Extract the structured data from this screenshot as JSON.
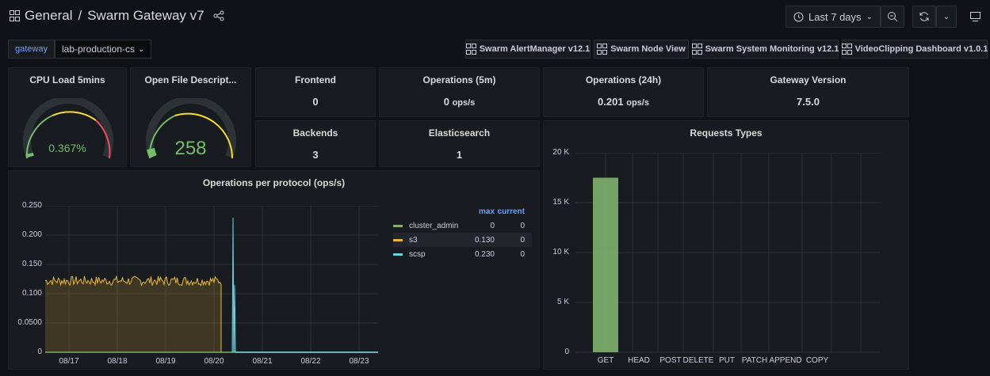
{
  "header": {
    "breadcrumb_folder": "General",
    "breadcrumb_sep": "/",
    "dashboard_title": "Swarm Gateway v7",
    "time_range": "Last 7 days"
  },
  "variables": {
    "label": "gateway",
    "value": "lab-production-cs"
  },
  "links": [
    "Swarm AlertManager v12.1",
    "Swarm Node View",
    "Swarm System Monitoring v12.1",
    "VideoClipping Dashboard v1.0.1"
  ],
  "panels": {
    "cpu": {
      "title": "CPU Load 5mins",
      "value": "0.367%",
      "level": 0.00367
    },
    "files": {
      "title": "Open File Descript...",
      "value": "258"
    },
    "frontend": {
      "title": "Frontend",
      "value": "0"
    },
    "ops5m": {
      "title": "Operations (5m)",
      "value": "0",
      "unit": "ops/s"
    },
    "ops24h": {
      "title": "Operations (24h)",
      "value": "0.201",
      "unit": "ops/s"
    },
    "version": {
      "title": "Gateway Version",
      "value": "7.5.0"
    },
    "backends": {
      "title": "Backends",
      "value": "3"
    },
    "elastic": {
      "title": "Elasticsearch",
      "value": "1"
    }
  },
  "ops_chart": {
    "title": "Operations per protocol (ops/s)",
    "legend_headers": {
      "max": "max",
      "current": "current"
    },
    "legend": [
      {
        "name": "cluster_admin",
        "max": "0",
        "current": "0",
        "color": "#7eb26d"
      },
      {
        "name": "s3",
        "max": "0.130",
        "current": "0",
        "color": "#eab839"
      },
      {
        "name": "scsp",
        "max": "0.230",
        "current": "0",
        "color": "#6ed0e0"
      }
    ]
  },
  "req_chart": {
    "title": "Requests Types"
  },
  "chart_data": [
    {
      "type": "line",
      "title": "Operations per protocol (ops/s)",
      "x": [
        "08/17",
        "08/18",
        "08/19",
        "08/20",
        "08/21",
        "08/22",
        "08/23"
      ],
      "y_ticks": [
        "0.250",
        "0.200",
        "0.150",
        "0.100",
        "0.0500",
        "0"
      ],
      "ylim": [
        0,
        0.25
      ],
      "series": [
        {
          "name": "cluster_admin",
          "description": "flat at 0"
        },
        {
          "name": "s3",
          "description": "noisy around 0.115-0.13 from 08/16 to 08/20 ~12:00, then 0",
          "level": 0.12,
          "max": 0.13
        },
        {
          "name": "scsp",
          "description": "0 except spike to 0.230 near 08/20 ~18:00",
          "max": 0.23
        }
      ]
    },
    {
      "type": "bar",
      "title": "Requests Types",
      "categories": [
        "GET",
        "HEAD",
        "POST",
        "DELETE",
        "PUT",
        "PATCH",
        "APPEND",
        "COPY"
      ],
      "values": [
        17500,
        0,
        0,
        0,
        0,
        0,
        0,
        0
      ],
      "y_ticks": [
        "20 K",
        "15 K",
        "10 K",
        "5 K",
        "0"
      ],
      "ylim": [
        0,
        20000
      ],
      "color": "#7eb26d"
    }
  ]
}
